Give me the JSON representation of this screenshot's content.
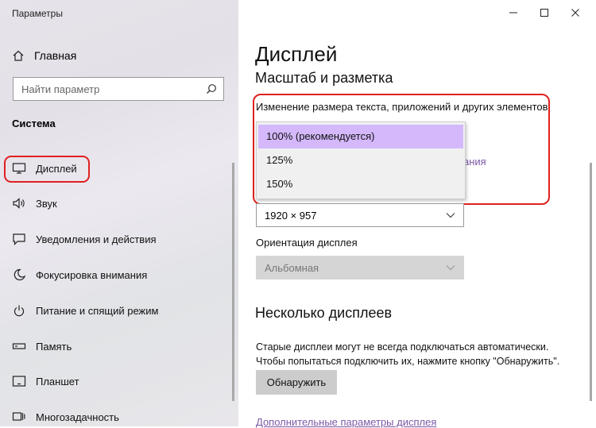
{
  "window": {
    "title": "Параметры"
  },
  "sidebar": {
    "home_label": "Главная",
    "search_placeholder": "Найти параметр",
    "section_title": "Система",
    "items": [
      {
        "label": "Дисплей",
        "icon": "monitor-icon"
      },
      {
        "label": "Звук",
        "icon": "speaker-icon"
      },
      {
        "label": "Уведомления и действия",
        "icon": "notification-icon"
      },
      {
        "label": "Фокусировка внимания",
        "icon": "moon-icon"
      },
      {
        "label": "Питание и спящий режим",
        "icon": "power-icon"
      },
      {
        "label": "Память",
        "icon": "storage-icon"
      },
      {
        "label": "Планшет",
        "icon": "tablet-icon"
      },
      {
        "label": "Многозадачность",
        "icon": "multitasking-icon"
      }
    ]
  },
  "main": {
    "title": "Дисплей",
    "subtitle": "Масштаб и разметка",
    "scale_label": "Изменение размера текста, приложений и других элементов",
    "scale_options": [
      "100% (рекомендуется)",
      "125%",
      "150%"
    ],
    "peek_link": "ания",
    "resolution_value": "1920 × 957",
    "orientation_label": "Ориентация дисплея",
    "orientation_value": "Альбомная",
    "multi_title": "Несколько дисплеев",
    "multi_desc_line1": "Старые дисплеи могут не всегда подключаться автоматически.",
    "multi_desc_line2": "Чтобы попытаться подключить их, нажмите кнопку \"Обнаружить\".",
    "detect_button": "Обнаружить",
    "advanced_link": "Дополнительные параметры дисплея"
  },
  "colors": {
    "highlight_red": "#e02020",
    "selected_option": "#d4b8fb",
    "link": "#7a58a6",
    "button": "#cccccc"
  }
}
